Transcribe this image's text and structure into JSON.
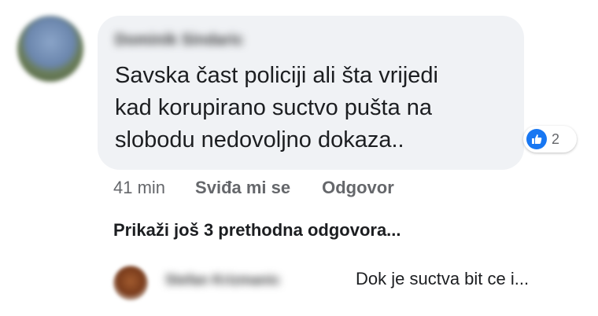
{
  "comment": {
    "author": "Dominik Sindaric",
    "text_lines": [
      "Savska čast policiji ali šta vrijedi",
      "kad korupirano suctvo pušta na",
      "slobodu nedovoljno dokaza.."
    ],
    "reaction_icon": "thumbs-up-icon",
    "reaction_count": "2",
    "time": "41 min",
    "like_label": "Sviđa mi se",
    "reply_label": "Odgovor"
  },
  "show_previous": "Prikaži još 3 prethodna odgovora...",
  "reply": {
    "author": "Stefan Krizmanic",
    "preview": "Dok je suctva bit ce i..."
  },
  "colors": {
    "bubble": "#f0f2f5",
    "like_blue": "#1877f2",
    "meta_gray": "#65676b"
  }
}
